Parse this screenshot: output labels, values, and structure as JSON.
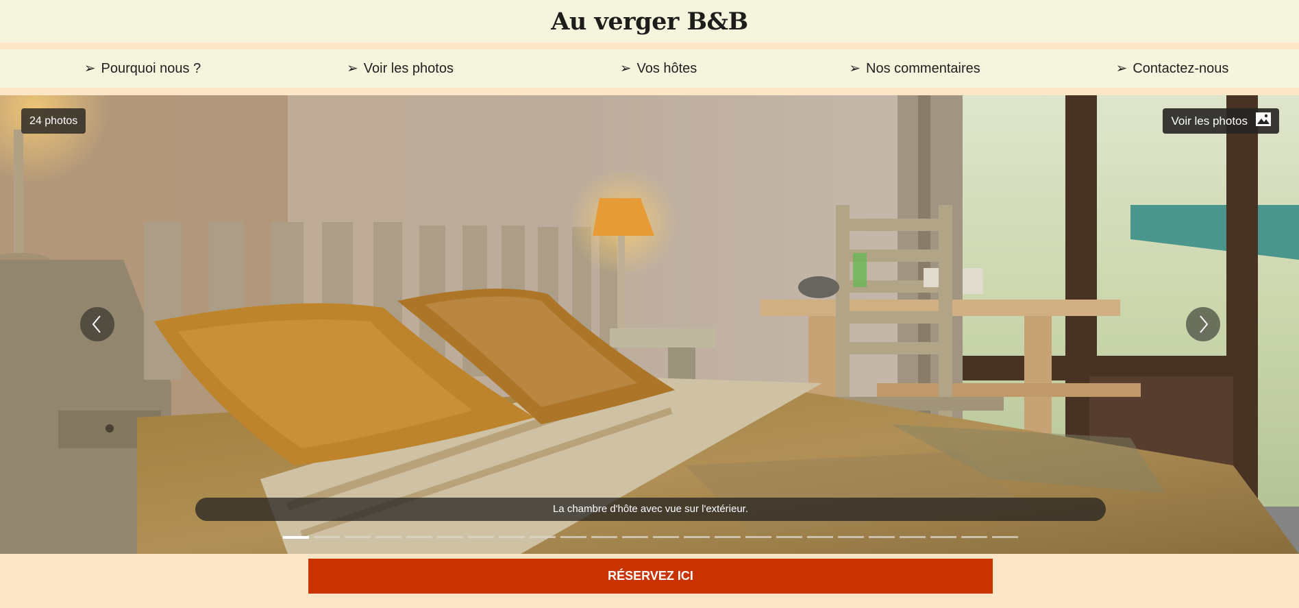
{
  "site": {
    "title": "Au verger B&B"
  },
  "nav": {
    "items": [
      {
        "label": "Pourquoi nous ?",
        "arrow": "➢"
      },
      {
        "label": "Voir les photos",
        "arrow": "➢"
      },
      {
        "label": "Vos hôtes",
        "arrow": "➢"
      },
      {
        "label": "Nos commentaires",
        "arrow": "➢"
      },
      {
        "label": "Contactez-nous",
        "arrow": "➢"
      }
    ]
  },
  "gallery": {
    "photo_count": "24 photos",
    "view_photos_label": "Voir les photos",
    "caption": "La chambre d'hôte avec vue sur l'extérieur.",
    "total_slides": 24,
    "active_slide": 1,
    "icons": {
      "prev": "chevron-left-icon",
      "next": "chevron-right-icon",
      "gallery": "image-icon"
    }
  },
  "booking": {
    "button_label": "RÉSERVEZ ICI"
  },
  "colors": {
    "header_bg": "#f5f4dc",
    "page_bg": "#fde6c8",
    "button_bg": "#c93300",
    "text": "#1d1d1b"
  }
}
